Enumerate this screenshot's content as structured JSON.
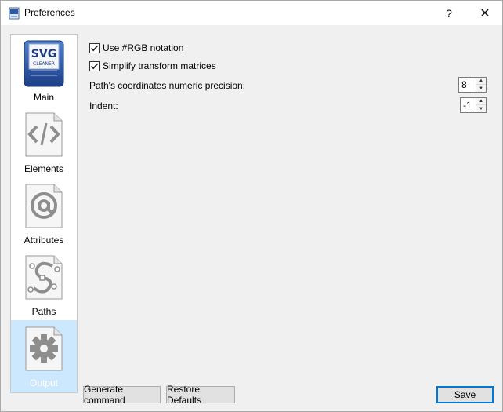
{
  "window": {
    "title": "Preferences",
    "help_glyph": "?",
    "close_glyph": "✕"
  },
  "sidebar": {
    "items": [
      {
        "label": "Main",
        "icon": "svg-cleaner-logo-icon",
        "selected": false
      },
      {
        "label": "Elements",
        "icon": "code-tag-icon",
        "selected": false
      },
      {
        "label": "Attributes",
        "icon": "at-sign-icon",
        "selected": false
      },
      {
        "label": "Paths",
        "icon": "bezier-path-icon",
        "selected": false
      },
      {
        "label": "Output",
        "icon": "gear-icon",
        "selected": true
      }
    ],
    "logo_text_top": "SVG",
    "logo_text_bottom": "CLEANER"
  },
  "options": {
    "rgb_notation": {
      "label": "Use #RGB notation",
      "checked": true
    },
    "simplify_matrices": {
      "label": "Simplify transform matrices",
      "checked": true
    },
    "precision": {
      "label": "Path's coordinates numeric precision:",
      "value": "8"
    },
    "indent": {
      "label": "Indent:",
      "value": "-1"
    }
  },
  "buttons": {
    "generate": "Generate command",
    "restore": "Restore Defaults",
    "save": "Save"
  },
  "colors": {
    "selected_bg": "#cce8ff",
    "default_button_border": "#0078d7"
  }
}
